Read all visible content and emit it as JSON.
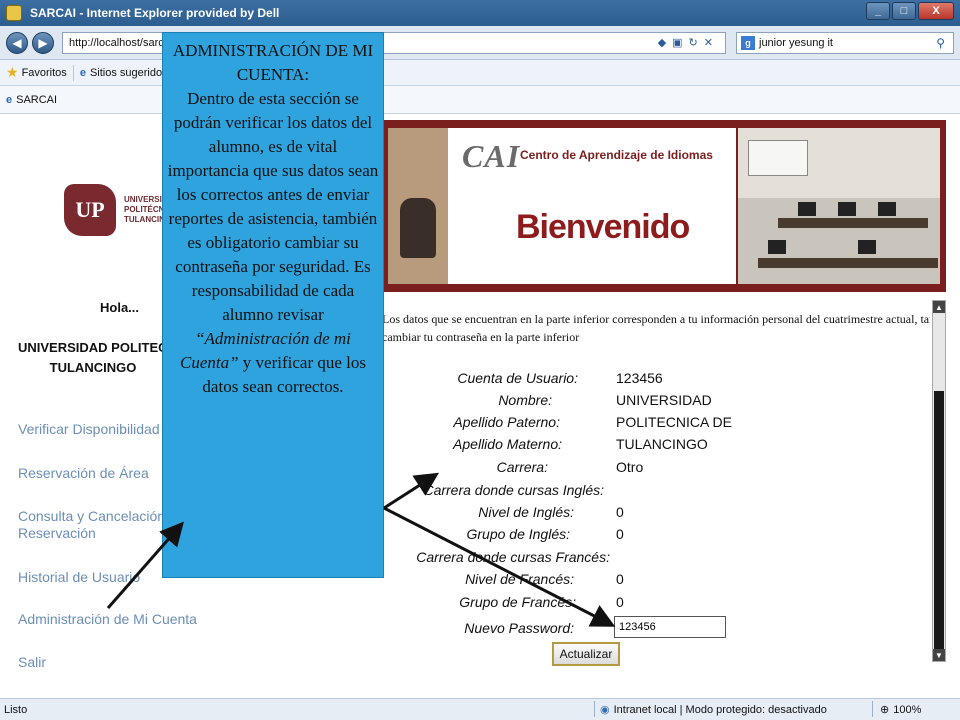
{
  "window": {
    "title": "SARCAI - Internet Explorer provided by Dell",
    "controls": [
      "_",
      "□",
      "X"
    ]
  },
  "addressbar": {
    "url": "http://localhost/sarca",
    "search_text": "junior yesung it"
  },
  "favbar": {
    "favorites_label": "Favoritos",
    "suggested_label": "Sitios sugeridos"
  },
  "tab": {
    "label": "SARCAI"
  },
  "sidebar": {
    "logo_text": [
      "UNIVERSIDAD",
      "POLITÉCNICA DE",
      "TULANCINGO"
    ],
    "greeting": "Hola...",
    "user_name_line1": "UNIVERSIDAD POLITECNICA DE",
    "user_name_line2": "TULANCINGO",
    "menu": [
      "Verificar Disponibilidad",
      "Reservación de Área",
      "Consulta y Cancelación de",
      "Reservación",
      "Historial de Usuario",
      "Administración de Mi Cuenta",
      "Salir"
    ]
  },
  "banner": {
    "logo": "CAI",
    "subtitle": "Centro de Aprendizaje de Idiomas",
    "welcome": "Bienvenido"
  },
  "intro": {
    "line1": "Los datos que se encuentran en la parte inferior corresponden a tu información personal del cuatrimestre actual, tambien puedes",
    "line2": "cambiar tu contraseña en la parte inferior"
  },
  "form": {
    "rows": [
      {
        "label": "Cuenta de Usuario:",
        "value": "123456"
      },
      {
        "label": "Nombre:",
        "value": "UNIVERSIDAD"
      },
      {
        "label": "Apellido Paterno:",
        "value": "POLITECNICA DE"
      },
      {
        "label": "Apellido Materno:",
        "value": "TULANCINGO"
      },
      {
        "label": "Carrera:",
        "value": "Otro"
      },
      {
        "label": "Carrera donde cursas Inglés:",
        "value": ""
      },
      {
        "label": "Nivel de Inglés:",
        "value": "0"
      },
      {
        "label": "Grupo de Inglés:",
        "value": "0"
      },
      {
        "label": "Carrera donde cursas Francés:",
        "value": ""
      },
      {
        "label": "Nivel de Francés:",
        "value": "0"
      },
      {
        "label": "Grupo de Francés:",
        "value": "0"
      }
    ],
    "password_label": "Nuevo Password:",
    "password_value": "123456",
    "submit_label": "Actualizar"
  },
  "callout": {
    "title": "ADMINISTRACIÓN DE MI CUENTA:",
    "body": "Dentro de esta sección se podrán verificar los datos del alumno, es de vital importancia que sus datos sean los correctos antes de enviar reportes de asistencia, también es obligatorio cambiar su contraseña por seguridad. Es responsabilidad de cada alumno revisar",
    "em": "“Administración de mi Cuenta”",
    "tail": " y verificar que los datos sean correctos."
  },
  "status": {
    "left": "Listo",
    "zone": "Intranet local | Modo protegido: desactivado",
    "zoom": "100%"
  },
  "colors": {
    "callout": "#2ea3de",
    "banner": "#7b1e1e",
    "menu_link": "#6b8fb7"
  }
}
